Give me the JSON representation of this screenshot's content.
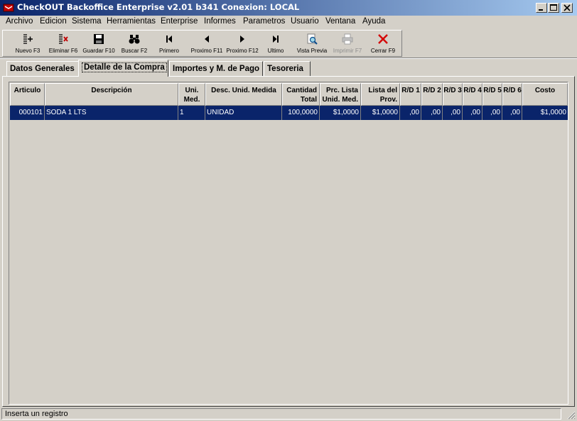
{
  "window": {
    "title": "CheckOUT Backoffice Enterprise v2.01 b341 Conexion: LOCAL"
  },
  "menu": [
    "Archivo",
    "Edicion",
    "Sistema",
    "Herramientas",
    "Enterprise",
    "Informes",
    "Parametros",
    "Usuario",
    "Ventana",
    "Ayuda"
  ],
  "toolbar": {
    "buttons": [
      {
        "label": "Nuevo F3",
        "icon": "new-record-icon",
        "enabled": true
      },
      {
        "label": "Eliminar F6",
        "icon": "delete-record-icon",
        "enabled": true
      },
      {
        "label": "Guardar F10",
        "icon": "floppy-disk-icon",
        "enabled": true
      },
      {
        "label": "Buscar F2",
        "icon": "binoculars-icon",
        "enabled": true
      },
      {
        "label": "Primero",
        "icon": "first-record-icon",
        "enabled": true
      },
      {
        "label": "Proximo F11",
        "icon": "previous-record-icon",
        "enabled": true
      },
      {
        "label": "Proximo F12",
        "icon": "next-record-icon",
        "enabled": true
      },
      {
        "label": "Ultimo",
        "icon": "last-record-icon",
        "enabled": true
      },
      {
        "label": "Vista Previa",
        "icon": "print-preview-icon",
        "enabled": true
      },
      {
        "label": "Imprimir F7",
        "icon": "printer-icon",
        "enabled": false
      },
      {
        "label": "Cerrar F9",
        "icon": "close-x-icon",
        "enabled": true
      }
    ]
  },
  "tabs": [
    {
      "label": "Datos Generales",
      "active": false
    },
    {
      "label": "Detalle de la Compra",
      "active": true
    },
    {
      "label": "Importes y M. de Pago",
      "active": false
    },
    {
      "label": "Tesoreria",
      "active": false
    }
  ],
  "grid": {
    "columns": [
      [
        "Articulo",
        ""
      ],
      [
        "Descripción",
        ""
      ],
      [
        "Uni.",
        "Med."
      ],
      [
        "Desc. Unid. Medida",
        ""
      ],
      [
        "Cantidad",
        "Total"
      ],
      [
        "Prc. Lista",
        "Unid. Med."
      ],
      [
        "Lista del",
        "Prov. Unid."
      ],
      [
        "R/D 1",
        ""
      ],
      [
        "R/D 2",
        ""
      ],
      [
        "R/D 3",
        ""
      ],
      [
        "R/D 4",
        ""
      ],
      [
        "R/D 5",
        ""
      ],
      [
        "R/D 6",
        ""
      ],
      [
        "Costo",
        ""
      ]
    ],
    "rows": [
      [
        "000101",
        "SODA 1 LTS",
        "1",
        "UNIDAD",
        "100,0000",
        "$1,0000",
        "$1,0000",
        ",00",
        ",00",
        ",00",
        ",00",
        ",00",
        ",00",
        "$1,0000"
      ]
    ]
  },
  "status": {
    "text": "Inserta un registro"
  },
  "colors": {
    "titlebar_start": "#0a246a",
    "titlebar_end": "#a6caf0",
    "selected_row": "#0a246a",
    "face": "#d4d0c8"
  }
}
